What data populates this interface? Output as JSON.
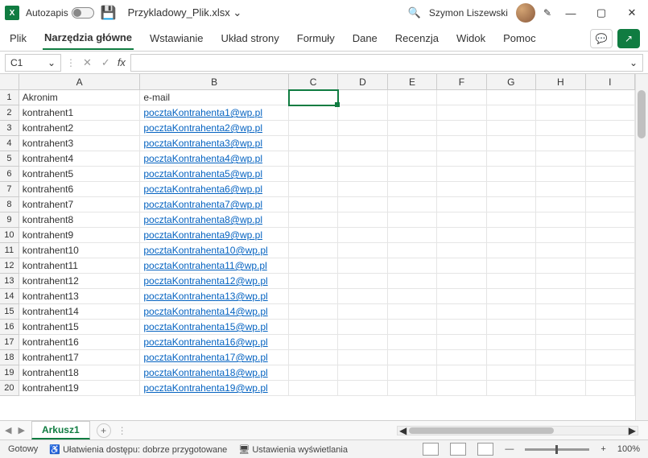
{
  "titlebar": {
    "autosave_label": "Autozapis",
    "filename": "Przykladowy_Plik.xlsx",
    "filename_chevron": "⌄",
    "user_name": "Szymon Liszewski"
  },
  "ribbon": {
    "tabs": [
      "Plik",
      "Narzędzia główne",
      "Wstawianie",
      "Układ strony",
      "Formuły",
      "Dane",
      "Recenzja",
      "Widok",
      "Pomoc"
    ],
    "active_index": 1,
    "comments_icon": "💬",
    "share_icon": "↗"
  },
  "formula_bar": {
    "name_box": "C1",
    "formula_value": ""
  },
  "columns": [
    {
      "label": "A",
      "class": "col-A"
    },
    {
      "label": "B",
      "class": "col-B"
    },
    {
      "label": "C",
      "class": "col-C"
    },
    {
      "label": "D",
      "class": "col-def"
    },
    {
      "label": "E",
      "class": "col-def"
    },
    {
      "label": "F",
      "class": "col-def"
    },
    {
      "label": "G",
      "class": "col-def"
    },
    {
      "label": "H",
      "class": "col-def"
    },
    {
      "label": "I",
      "class": "col-def"
    }
  ],
  "selected_cell": {
    "row": 1,
    "col": 2
  },
  "rows": [
    {
      "n": 1,
      "A": "Akronim",
      "B": "e-mail",
      "B_link": false
    },
    {
      "n": 2,
      "A": "kontrahent1",
      "B": "pocztaKontrahenta1@wp.pl",
      "B_link": true
    },
    {
      "n": 3,
      "A": "kontrahent2",
      "B": "pocztaKontrahenta2@wp.pl",
      "B_link": true
    },
    {
      "n": 4,
      "A": "kontrahent3",
      "B": "pocztaKontrahenta3@wp.pl",
      "B_link": true
    },
    {
      "n": 5,
      "A": "kontrahent4",
      "B": "pocztaKontrahenta4@wp.pl",
      "B_link": true
    },
    {
      "n": 6,
      "A": "kontrahent5",
      "B": "pocztaKontrahenta5@wp.pl",
      "B_link": true
    },
    {
      "n": 7,
      "A": "kontrahent6",
      "B": "pocztaKontrahenta6@wp.pl",
      "B_link": true
    },
    {
      "n": 8,
      "A": "kontrahent7",
      "B": "pocztaKontrahenta7@wp.pl",
      "B_link": true
    },
    {
      "n": 9,
      "A": "kontrahent8",
      "B": "pocztaKontrahenta8@wp.pl",
      "B_link": true
    },
    {
      "n": 10,
      "A": "kontrahent9",
      "B": "pocztaKontrahenta9@wp.pl",
      "B_link": true
    },
    {
      "n": 11,
      "A": "kontrahent10",
      "B": "pocztaKontrahenta10@wp.pl",
      "B_link": true
    },
    {
      "n": 12,
      "A": "kontrahent11",
      "B": "pocztaKontrahenta11@wp.pl",
      "B_link": true
    },
    {
      "n": 13,
      "A": "kontrahent12",
      "B": "pocztaKontrahenta12@wp.pl",
      "B_link": true
    },
    {
      "n": 14,
      "A": "kontrahent13",
      "B": "pocztaKontrahenta13@wp.pl",
      "B_link": true
    },
    {
      "n": 15,
      "A": "kontrahent14",
      "B": "pocztaKontrahenta14@wp.pl",
      "B_link": true
    },
    {
      "n": 16,
      "A": "kontrahent15",
      "B": "pocztaKontrahenta15@wp.pl",
      "B_link": true
    },
    {
      "n": 17,
      "A": "kontrahent16",
      "B": "pocztaKontrahenta16@wp.pl",
      "B_link": true
    },
    {
      "n": 18,
      "A": "kontrahent17",
      "B": "pocztaKontrahenta17@wp.pl",
      "B_link": true
    },
    {
      "n": 19,
      "A": "kontrahent18",
      "B": "pocztaKontrahenta18@wp.pl",
      "B_link": true
    },
    {
      "n": 20,
      "A": "kontrahent19",
      "B": "pocztaKontrahenta19@wp.pl",
      "B_link": true
    }
  ],
  "sheet_tabs": {
    "active": "Arkusz1"
  },
  "status_bar": {
    "ready": "Gotowy",
    "accessibility": "Ułatwienia dostępu: dobrze przygotowane",
    "display_settings": "Ustawienia wyświetlania",
    "zoom": "100%"
  }
}
